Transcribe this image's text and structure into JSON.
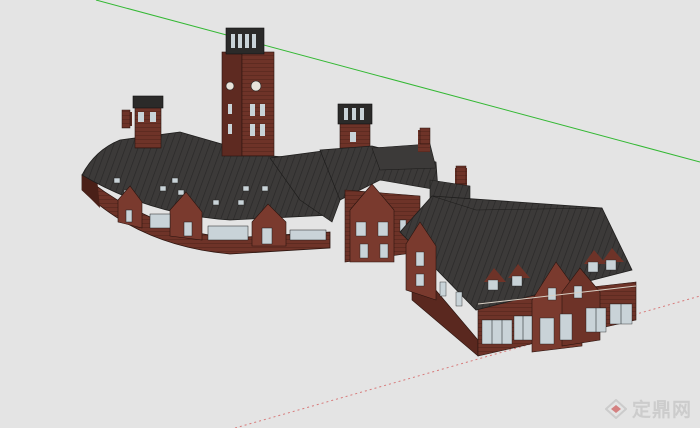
{
  "viewport": {
    "background": "#e4e4e4",
    "axes": {
      "green": "#33b833",
      "red": "#d77a7a"
    }
  },
  "model": {
    "subject": "red-brick-clock-tower-building-complex",
    "colors": {
      "brick": "#6e3328",
      "brick_dark": "#4a2018",
      "brick_light": "#8a4436",
      "roof": "#3c3a39",
      "roof_dark": "#272626",
      "window": "#c9d3d8",
      "window_dark": "#2b2f33",
      "trim": "#d8cfc4"
    }
  },
  "watermark": {
    "text": "定鼎网",
    "icon": "diamond-logo-icon",
    "color": "#c8c8c8"
  }
}
